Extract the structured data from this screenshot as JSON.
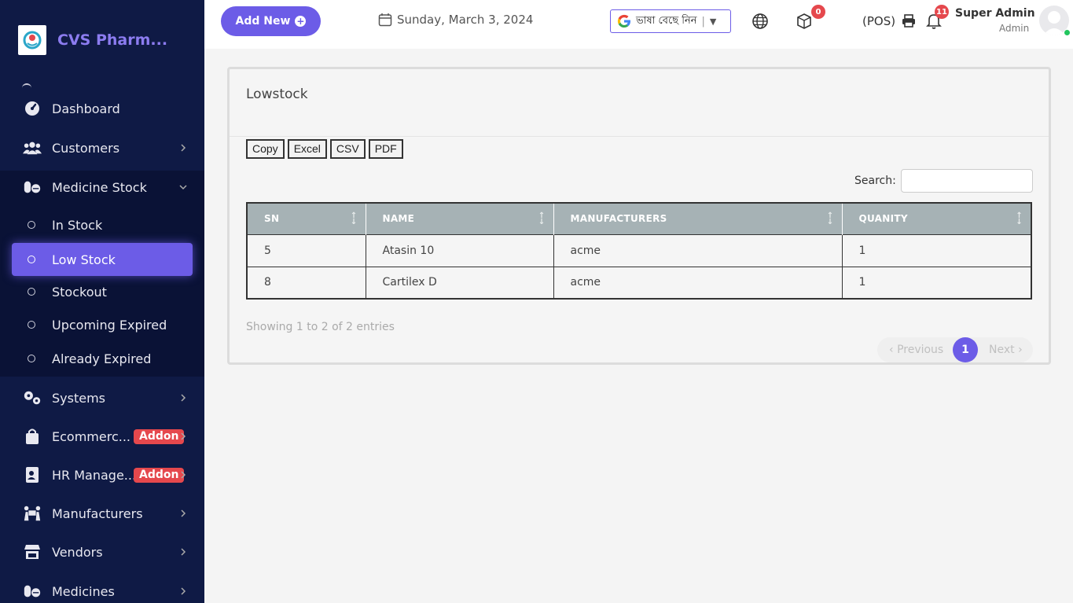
{
  "sidebar": {
    "brand": "CVS Pharm...",
    "items": [
      {
        "label": "Dashboard"
      },
      {
        "label": "Customers"
      },
      {
        "label": "Medicine Stock"
      },
      {
        "label": "Systems"
      },
      {
        "label": "Ecommerc...",
        "badge": "Addon"
      },
      {
        "label": "HR Manage...",
        "badge": "Addon"
      },
      {
        "label": "Manufacturers"
      },
      {
        "label": "Vendors"
      },
      {
        "label": "Medicines"
      }
    ],
    "submenu": [
      {
        "label": "In Stock"
      },
      {
        "label": "Low Stock",
        "active": true
      },
      {
        "label": "Stockout"
      },
      {
        "label": "Upcoming Expired"
      },
      {
        "label": "Already Expired"
      }
    ]
  },
  "topbar": {
    "add_new": "Add New",
    "date": "Sunday, March 3, 2024",
    "language": "ভাষা বেছে নিন",
    "package_count": "0",
    "pos": "(POS)",
    "notification_count": "11",
    "user_name": "Super Admin",
    "user_role": "Admin"
  },
  "card": {
    "title": "Lowstock",
    "buttons": [
      "Copy",
      "Excel",
      "CSV",
      "PDF"
    ],
    "search_label": "Search:",
    "search_value": ""
  },
  "table": {
    "columns": [
      "SN",
      "NAME",
      "MANUFACTURERS",
      "QUANITY"
    ],
    "rows": [
      [
        "5",
        "Atasin 10",
        "acme",
        "1"
      ],
      [
        "8",
        "Cartilex D",
        "acme",
        "1"
      ]
    ]
  },
  "footer": {
    "info": "Showing 1 to 2 of 2 entries",
    "previous": "Previous",
    "page": "1",
    "next": "Next"
  },
  "colors": {
    "sidebar_bg": "#0f1a45",
    "accent": "#6c5ce7",
    "addon_badge": "#e5484d",
    "table_header": "#a6b2b5"
  }
}
